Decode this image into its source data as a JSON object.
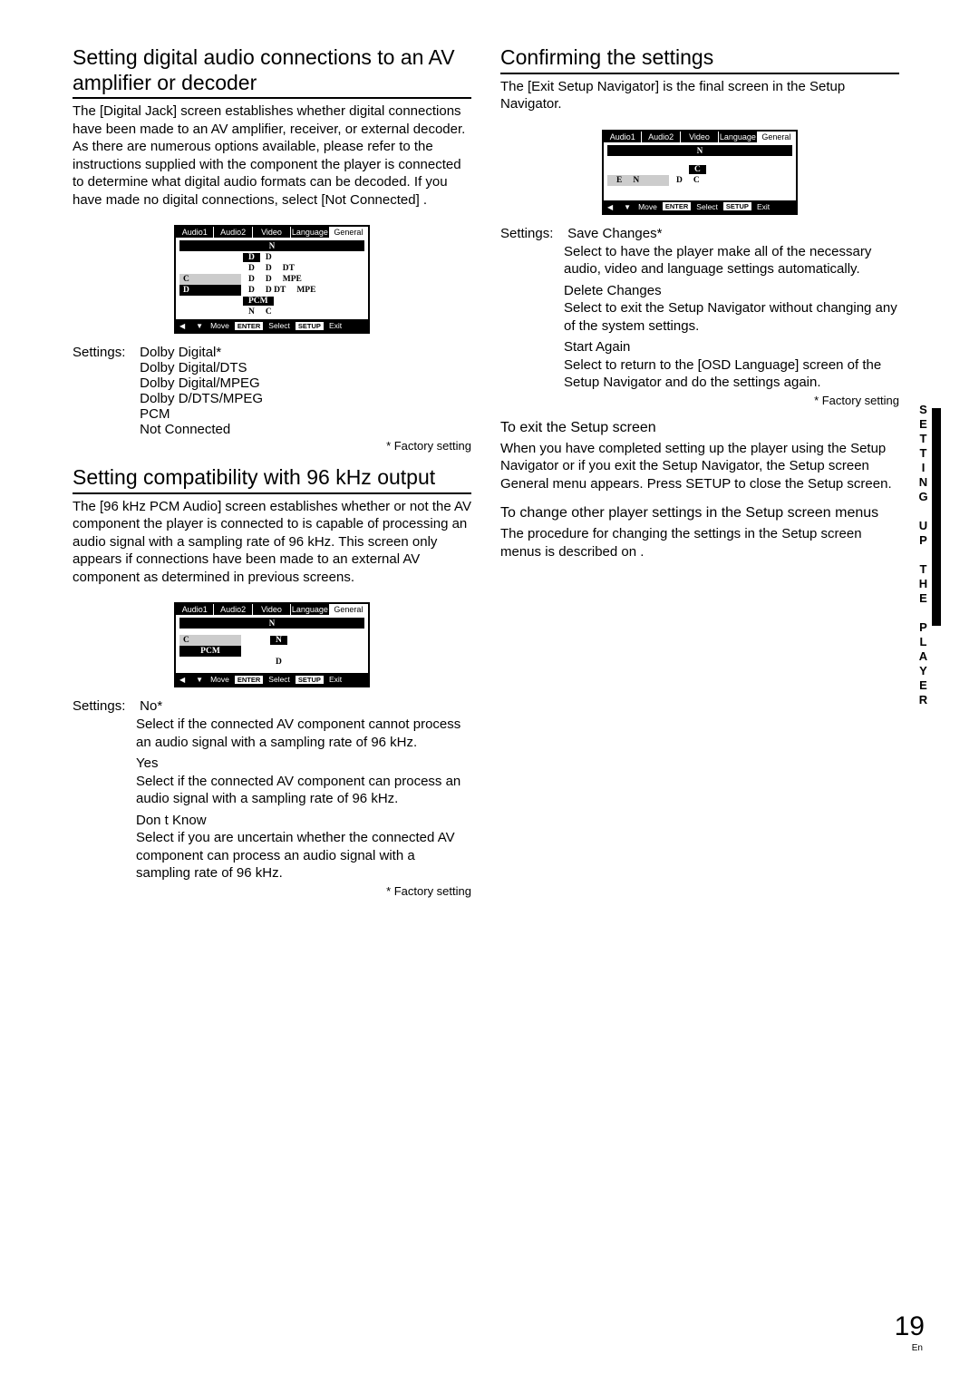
{
  "left": {
    "h1": "Setting digital audio connections to an AV amplifier or decoder",
    "p1": "The [Digital Jack]  screen establishes whether digital connections have been made to an AV amplifier, receiver, or external decoder. As there are numerous options available, please refer to the instructions supplied with the component the player is connected to determine what digital audio formats can be decoded. If you have made no digital connections, select [Not Connected] .",
    "settings1_label": "Settings:",
    "settings1": [
      "Dolby Digital*",
      "Dolby Digital/DTS",
      "Dolby Digital/MPEG",
      "Dolby D/DTS/MPEG",
      "PCM",
      "Not Connected"
    ],
    "factory": "* Factory setting",
    "h2": "Setting compatibility with 96 kHz output",
    "p2": "The [96 kHz PCM Audio]  screen establishes whether or not the AV component the player is connected to is capable of processing an audio signal with a sampling rate of 96 kHz. This screen only appears if connections have been made to an external AV component as determined in previous screens.",
    "settings2_label": "Settings:",
    "s2_head": "No*",
    "s2_items": [
      {
        "t": "",
        "d": "Select if the connected AV component cannot process an audio signal with a sampling rate of 96 kHz."
      },
      {
        "t": "Yes",
        "d": "Select if the connected AV component can process an audio signal with a sampling rate of 96 kHz."
      },
      {
        "t": "Don t Know",
        "d": "Select if you are uncertain whether the connected AV component can process an audio signal with a sampling rate of 96 kHz."
      }
    ]
  },
  "right": {
    "h1": "Confirming the settings",
    "p1": "The [Exit Setup Navigator]    is the final screen in the Setup  Navigator.",
    "settings_label": "Settings:",
    "s_head": "Save Changes*",
    "s_items": [
      {
        "t": "",
        "d": "Select to have the player make all of the necessary audio, video and language settings automatically."
      },
      {
        "t": "Delete Changes",
        "d": "Select to exit the Setup Navigator without changing any of the system settings."
      },
      {
        "t": "Start Again",
        "d": "Select to return to the  [OSD Language] screen of the Setup Navigator and do the settings again."
      }
    ],
    "factory": "* Factory setting",
    "h3a": "To exit the Setup screen",
    "p3a": "When you have completed setting up the player using the Setup Navigator or if you exit the Setup Navigator, the Setup screen General  menu appears. Press SETUP to close the Setup screen.",
    "h3b": "To change other player settings in the Setup screen menus",
    "p3b": "The procedure for changing the settings in the Setup screen menus is described on              ."
  },
  "osd": {
    "tabs": [
      "Audio1",
      "Audio2",
      "Video",
      "Language",
      "General"
    ],
    "foot_move": "Move",
    "foot_enter": "ENTER",
    "foot_select": "Select",
    "foot_setup": "SETUP",
    "foot_exit": "Exit"
  },
  "side_text": "SETTING UP THE PLAYER",
  "page_num": "19",
  "page_lang": "En"
}
